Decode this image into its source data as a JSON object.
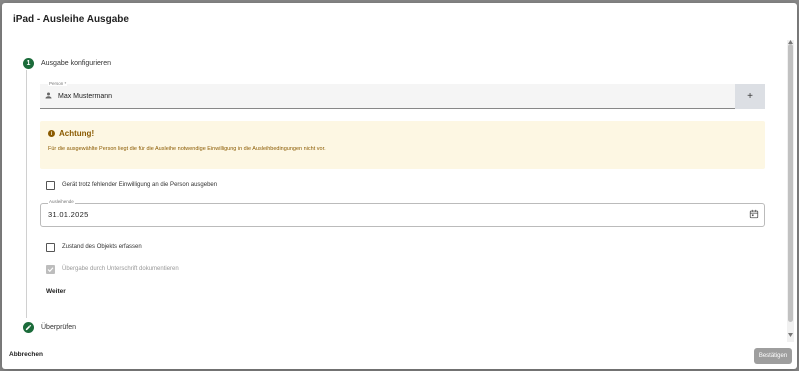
{
  "dialog": {
    "title": "iPad - Ausleihe Ausgabe"
  },
  "stepper": {
    "step1": {
      "number": "1",
      "label": "Ausgabe konfigurieren"
    },
    "step2": {
      "label": "Überprüfen",
      "icon": "pencil-icon"
    }
  },
  "person": {
    "label": "Person *",
    "value": "Max Mustermann",
    "icon": "person-icon",
    "add_label": "+"
  },
  "alert": {
    "title": "Achtung!",
    "text": "Für die ausgewählte Person liegt die für die Ausleihe notwendige Einwilligung in die Ausleihbedingungen nicht vor.",
    "icon": "info-icon",
    "icon_glyph": "i"
  },
  "checkboxes": {
    "consent_override": {
      "label": "Gerät trotz fehlender Einwilligung an die Person ausgeben",
      "checked": false
    },
    "condition": {
      "label": "Zustand des Objekts erfassen",
      "checked": false
    },
    "signature": {
      "label": "Übergabe durch Unterschrift dokumentieren",
      "checked": true,
      "disabled": true
    }
  },
  "loan_end": {
    "label": "Ausleihende",
    "value": "31.01.2025",
    "icon": "calendar-icon"
  },
  "buttons": {
    "next": "Weiter",
    "cancel": "Abbrechen",
    "confirm": "Bestätigen"
  },
  "colors": {
    "primary": "#1b6b3a",
    "warning_text": "#8a5a00",
    "warning_bg": "#fdf7e3"
  }
}
